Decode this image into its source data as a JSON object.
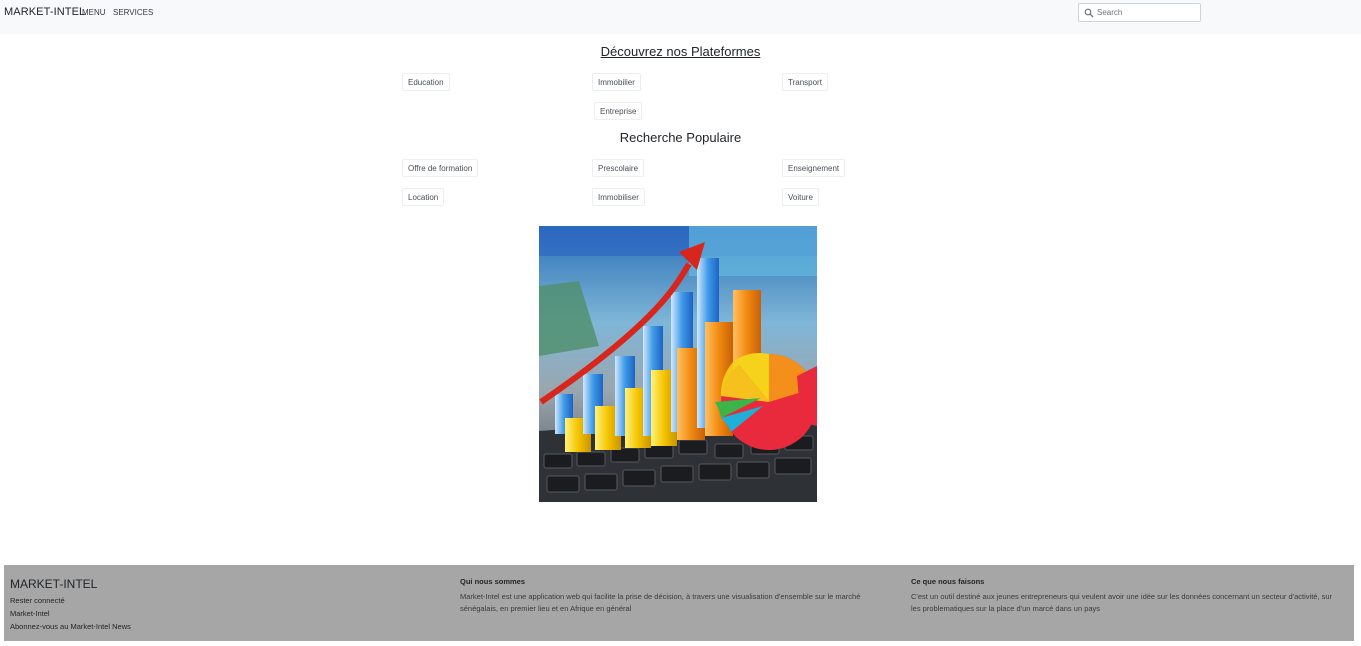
{
  "navbar": {
    "brand": "MARKET-INTEL",
    "links": [
      "MENU",
      "SERVICES"
    ],
    "search_placeholder": "Search"
  },
  "platforms": {
    "title": "Découvrez nos Plateformes",
    "items": [
      "Education",
      "Immobilier",
      "Transport",
      "Entreprise"
    ]
  },
  "popular": {
    "title": "Recherche Populaire",
    "items": [
      "Offre de formation",
      "Prescolaire",
      "Enseignement",
      "Location",
      "Immobiliser",
      "Voiture"
    ]
  },
  "hero_image": {
    "icon": "bar-chart-pie-illustration",
    "colors": [
      "#2f8fe0",
      "#f5a623",
      "#e82a3c",
      "#f7d21a",
      "#3bb44a"
    ]
  },
  "footer": {
    "brand": "MARKET-INTEL",
    "links": [
      "Rester connecté",
      "Market-Intel",
      "Abonnez-vous au Market-Intel News"
    ],
    "about_title": "Qui nous sommes",
    "about_text": "Market-Intel est une application web qui facilite la prise de décision, à travers une visualisation d'ensemble sur le marché sénégalais, en premier lieu et en Afrique en général",
    "what_title": "Ce que nous faisons",
    "what_text": "C'est un outil destiné aux jeunes entrepreneurs qui veulent avoir une idée sur les données concernant un secteur d'activité, sur les problematiques sur la place d'un marcé dans un pays"
  }
}
